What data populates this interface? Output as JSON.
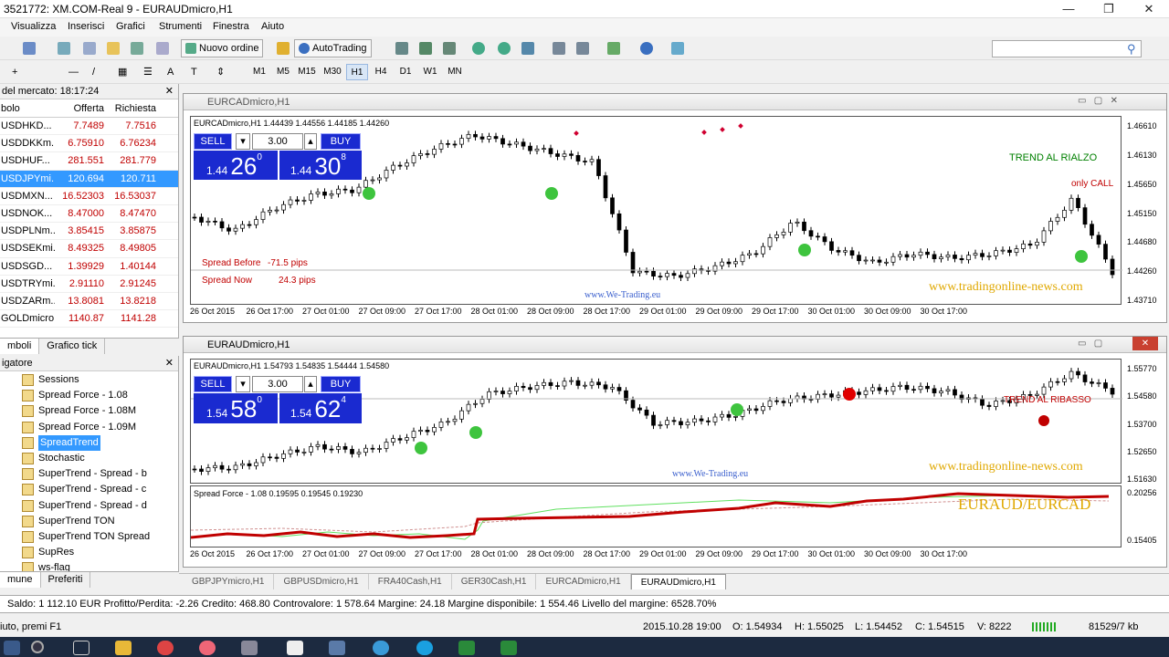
{
  "window": {
    "title": "3521772: XM.COM-Real 9 - EURAUDmicro,H1",
    "min": "—",
    "max": "❐",
    "close": "✕"
  },
  "menu": [
    "Visualizza",
    "Inserisci",
    "Grafici",
    "Strumenti",
    "Finestra",
    "Aiuto"
  ],
  "toolbar": {
    "new_order": "Nuovo ordine",
    "autotrading": "AutoTrading"
  },
  "timeframes": [
    "M1",
    "M5",
    "M15",
    "M30",
    "H1",
    "H4",
    "D1",
    "W1",
    "MN"
  ],
  "market_watch": {
    "title": "del mercato: 18:17:24",
    "cols": [
      "bolo",
      "Offerta",
      "Richiesta"
    ],
    "rows": [
      {
        "s": "USDHKD...",
        "b": "7.7489",
        "a": "7.7516"
      },
      {
        "s": "USDDKKm...",
        "b": "6.75910",
        "a": "6.76234"
      },
      {
        "s": "USDHUF...",
        "b": "281.551",
        "a": "281.779"
      },
      {
        "s": "USDJPYmi...",
        "b": "120.694",
        "a": "120.711"
      },
      {
        "s": "USDMXN...",
        "b": "16.52303",
        "a": "16.53037"
      },
      {
        "s": "USDNOK...",
        "b": "8.47000",
        "a": "8.47470"
      },
      {
        "s": "USDPLNm...",
        "b": "3.85415",
        "a": "3.85875"
      },
      {
        "s": "USDSEKmi...",
        "b": "8.49325",
        "a": "8.49805"
      },
      {
        "s": "USDSGD...",
        "b": "1.39929",
        "a": "1.40144"
      },
      {
        "s": "USDTRYmi...",
        "b": "2.91110",
        "a": "2.91245"
      },
      {
        "s": "USDZARm...",
        "b": "13.8081",
        "a": "13.8218"
      },
      {
        "s": "GOLDmicro",
        "b": "1140.87",
        "a": "1141.28"
      }
    ],
    "tabs": [
      "mboli",
      "Grafico tick"
    ]
  },
  "navigator": {
    "title": "igatore",
    "items": [
      "Sessions",
      "Spread Force - 1.08",
      "Spread Force - 1.08M",
      "Spread Force - 1.09M",
      "SpreadTrend",
      "Stochastic",
      "SuperTrend - Spread - b",
      "SuperTrend - Spread - c",
      "SuperTrend - Spread - d",
      "SuperTrend TON",
      "SuperTrend TON Spread",
      "SupRes",
      "ws-flag"
    ],
    "tabs": [
      "mune",
      "Preferiti"
    ]
  },
  "chart1": {
    "window_title": "EURCADmicro,H1",
    "info": "EURCADmicro,H1  1.44439 1.44556 1.44185 1.44260",
    "sell": "SELL",
    "buy": "BUY",
    "qty": "3.00",
    "sell_small": "1.44",
    "sell_big": "26",
    "sell_sup": "0",
    "buy_small": "1.44",
    "buy_big": "30",
    "buy_sup": "8",
    "trend": "TREND AL RIALZO",
    "call": "only CALL",
    "spread_before_label": "Spread Before",
    "spread_before": "-71.5 pips",
    "spread_now_label": "Spread Now",
    "spread_now": "24.3 pips",
    "site": "www.tradingonline-news.com",
    "wetrading": "www.We-Trading.eu",
    "yaxis": [
      "1.46610",
      "1.46130",
      "1.45650",
      "1.45150",
      "1.44680",
      "1.44260",
      "1.43710"
    ],
    "xaxis": [
      "26 Oct 2015",
      "26 Oct 17:00",
      "27 Oct 01:00",
      "27 Oct 09:00",
      "27 Oct 17:00",
      "28 Oct 01:00",
      "28 Oct 09:00",
      "28 Oct 17:00",
      "29 Oct 01:00",
      "29 Oct 09:00",
      "29 Oct 17:00",
      "30 Oct 01:00",
      "30 Oct 09:00",
      "30 Oct 17:00"
    ]
  },
  "chart2": {
    "window_title": "EURAUDmicro,H1",
    "info": "EURAUDmicro,H1  1.54793 1.54835 1.54444 1.54580",
    "sell": "SELL",
    "buy": "BUY",
    "qty": "3.00",
    "sell_small": "1.54",
    "sell_big": "58",
    "sell_sup": "0",
    "buy_small": "1.54",
    "buy_big": "62",
    "buy_sup": "4",
    "trend": "TREND AL RIBASSO",
    "site": "www.tradingonline-news.com",
    "wetrading": "www.We-Trading.eu",
    "yaxis": [
      "1.55770",
      "1.54580",
      "1.53700",
      "1.52650",
      "1.51630"
    ],
    "sub_info": "Spread Force - 1.08  0.19595  0.19545  0.19230",
    "sub_label": "EURAUD/EURCAD",
    "sub_yaxis": [
      "0.20256",
      "0.15405"
    ],
    "xaxis": [
      "26 Oct 2015",
      "26 Oct 17:00",
      "27 Oct 01:00",
      "27 Oct 09:00",
      "27 Oct 17:00",
      "28 Oct 01:00",
      "28 Oct 09:00",
      "28 Oct 17:00",
      "29 Oct 01:00",
      "29 Oct 09:00",
      "29 Oct 17:00",
      "30 Oct 01:00",
      "30 Oct 09:00",
      "30 Oct 17:00"
    ]
  },
  "chart_tabs": [
    "GBPJPYmicro,H1",
    "GBPUSDmicro,H1",
    "FRA40Cash,H1",
    "GER30Cash,H1",
    "EURCADmicro,H1",
    "EURAUDmicro,H1"
  ],
  "account": "Saldo: 1 112.10 EUR  Profitto/Perdita: -2.26  Credito: 468.80  Controvalore: 1 578.64  Margine: 24.18  Margine disponibile: 1 554.46  Livello del margine: 6528.70%",
  "status": {
    "help": "iuto, premi F1",
    "datetime": "2015.10.28 19:00",
    "o": "O: 1.54934",
    "h": "H: 1.55025",
    "l": "L: 1.54452",
    "c": "C: 1.54515",
    "v": "V: 8222",
    "traffic": "81529/7 kb"
  }
}
